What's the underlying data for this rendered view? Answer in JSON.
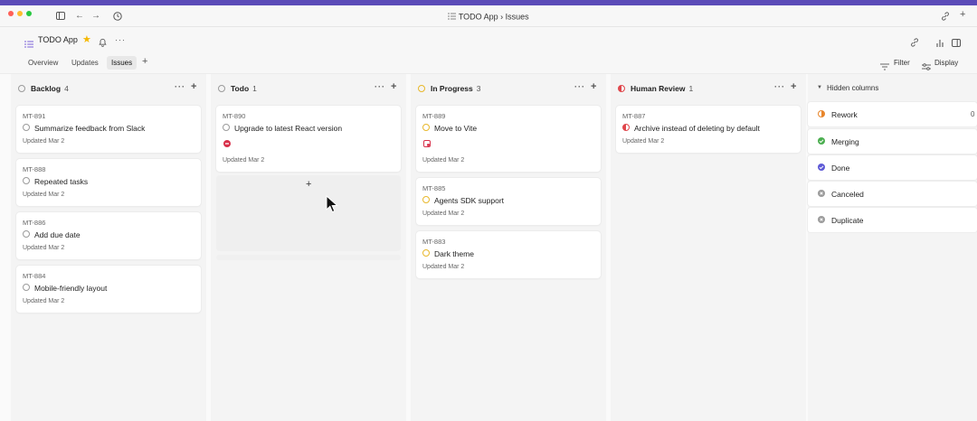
{
  "window": {
    "title": "TODO App › Issues"
  },
  "header": {
    "app_name": "TODO App"
  },
  "tabs": [
    {
      "label": "Overview"
    },
    {
      "label": "Updates"
    },
    {
      "label": "Issues"
    }
  ],
  "toolbar": {
    "filter_label": "Filter",
    "display_label": "Display"
  },
  "columns": [
    {
      "name": "Backlog",
      "count": "4",
      "status_color": "#9b9b9b",
      "cards": [
        {
          "id": "MT-891",
          "title": "Summarize feedback from Slack",
          "updated": "Updated Mar 2"
        },
        {
          "id": "MT-888",
          "title": "Repeated tasks",
          "updated": "Updated Mar 2"
        },
        {
          "id": "MT-886",
          "title": "Add due date",
          "updated": "Updated Mar 2"
        },
        {
          "id": "MT-884",
          "title": "Mobile-friendly layout",
          "updated": "Updated Mar 2"
        }
      ]
    },
    {
      "name": "Todo",
      "count": "1",
      "status_color": "#9b9b9b",
      "cards": [
        {
          "id": "MT-890",
          "title": "Upgrade to latest React version",
          "updated": "Updated Mar 2"
        }
      ],
      "add_label": "+"
    },
    {
      "name": "In Progress",
      "count": "3",
      "status_color": "#e8b82c",
      "cards": [
        {
          "id": "MT-889",
          "title": "Move to Vite",
          "updated": "Updated Mar 2"
        },
        {
          "id": "MT-885",
          "title": "Agents SDK support",
          "updated": "Updated Mar 2"
        },
        {
          "id": "MT-883",
          "title": "Dark theme",
          "updated": "Updated Mar 2"
        }
      ]
    },
    {
      "name": "Human Review",
      "count": "1",
      "status_color": "#e0474c",
      "cards": [
        {
          "id": "MT-887",
          "title": "Archive instead of deleting by default",
          "updated": "Updated Mar 2"
        }
      ]
    }
  ],
  "hidden_columns": {
    "title": "Hidden columns",
    "items": [
      {
        "label": "Rework",
        "count": "0",
        "color": "#e8862c"
      },
      {
        "label": "Merging",
        "color": "#4caf50"
      },
      {
        "label": "Done",
        "color": "#5e5ad6"
      },
      {
        "label": "Canceled",
        "color": "#9b9b9b"
      },
      {
        "label": "Duplicate",
        "color": "#9b9b9b"
      }
    ]
  }
}
